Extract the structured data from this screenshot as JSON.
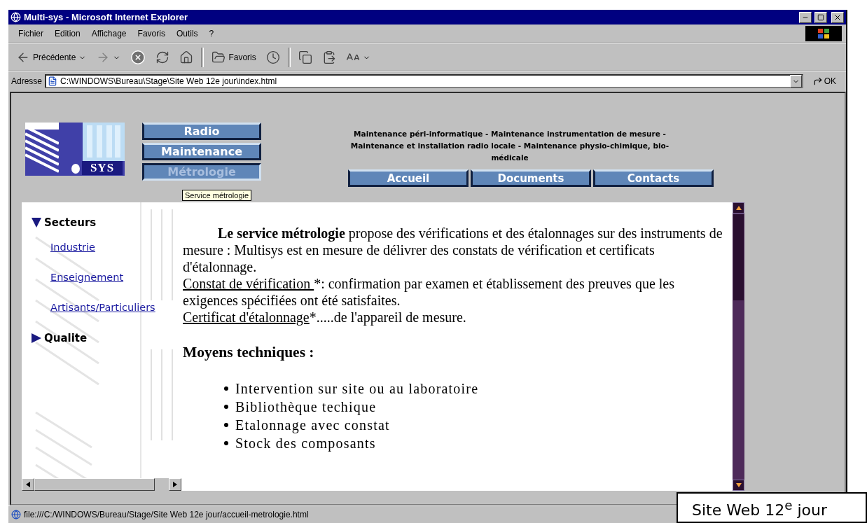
{
  "window": {
    "title": "Multi-sys - Microsoft Internet Explorer"
  },
  "menu": [
    {
      "label": "Fichier"
    },
    {
      "label": "Edition"
    },
    {
      "label": "Affichage"
    },
    {
      "label": "Favoris"
    },
    {
      "label": "Outils"
    },
    {
      "label": "?"
    }
  ],
  "toolbar": [
    {
      "kind": "back",
      "label": "Précédente"
    },
    {
      "kind": "forward"
    },
    {
      "kind": "stop"
    },
    {
      "kind": "refresh"
    },
    {
      "kind": "home"
    },
    {
      "kind": "favorites",
      "label": "Favoris"
    },
    {
      "kind": "history"
    },
    {
      "kind": "copy"
    },
    {
      "kind": "paste"
    },
    {
      "kind": "fonts"
    }
  ],
  "address": {
    "label": "Adresse",
    "value": "C:\\WINDOWS\\Bureau\\Stage\\Site Web 12e jour\\index.html",
    "go": "OK"
  },
  "page": {
    "logo": {
      "text": "SYS"
    },
    "side_nav": [
      {
        "label": "Radio",
        "selected": false
      },
      {
        "label": "Maintenance",
        "selected": false
      },
      {
        "label": "Métrologie",
        "selected": true
      }
    ],
    "header_lines": [
      "Maintenance péri-informatique - Maintenance instrumentation de mesure -",
      "Maintenance et installation radio locale - Maintenance physio-chimique, bio-",
      "médicale"
    ],
    "top_nav": [
      {
        "label": "Accueil"
      },
      {
        "label": "Documents"
      },
      {
        "label": "Contacts"
      }
    ],
    "tooltip": "Service métrologie",
    "sidebar": [
      {
        "label": "Secteurs",
        "expanded": true,
        "children": [
          {
            "label": "Industrie"
          },
          {
            "label": "Enseignement"
          },
          {
            "label": "Artisants/Particuliers"
          }
        ]
      },
      {
        "label": "Qualite",
        "expanded": false
      }
    ],
    "intro": "**Le service métrologie** propose des vérifications et des étalonnages sur des instruments de mesure : Multisys est en mesure de délivrer des constats de vérification et certificats d'étalonnage.",
    "definitions": [
      {
        "term": "Constat de vérification ",
        "text": "*: confirmation par examen et établissement des preuves que les exigences spécifiées ont été satisfaites."
      },
      {
        "term": "Certificat d'étalonnage",
        "text": "*.....de l'appareil de mesure."
      }
    ],
    "heading": "Moyens techniques :",
    "bullets": [
      "Intervention sur site ou au laboratoire",
      "Bibliothèque techique",
      "Etalonnage avec constat",
      "Stock des composants"
    ]
  },
  "status_bar": {
    "url": "file:///C:/WINDOWS/Bureau/Stage/Site Web 12e jour/accueil-metrologie.html"
  },
  "caption": "Site Web 12$^{e}$ jour"
}
